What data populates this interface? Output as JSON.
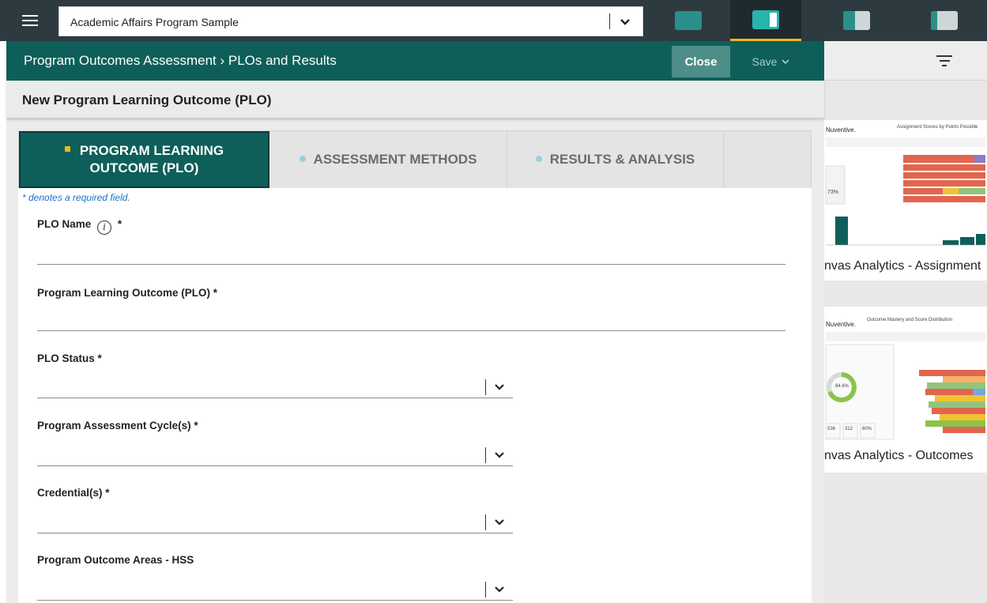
{
  "topbar": {
    "org_select_value": "Academic Affairs Program Sample",
    "layout_buttons": [
      {
        "name": "layout-full"
      },
      {
        "name": "layout-split-right",
        "active": true
      },
      {
        "name": "layout-split-left"
      },
      {
        "name": "layout-split-center"
      }
    ]
  },
  "modal": {
    "breadcrumb": "Program Outcomes Assessment  ›  PLOs and Results",
    "close_label": "Close",
    "save_label": "Save",
    "subtitle": "New Program Learning Outcome (PLO)",
    "tabs": [
      {
        "line1": "PROGRAM LEARNING",
        "line2": "OUTCOME (PLO)",
        "active": true
      },
      {
        "label": "ASSESSMENT METHODS",
        "active": false
      },
      {
        "label": "RESULTS & ANALYSIS",
        "active": false
      }
    ],
    "required_note": "* denotes a required field.",
    "fields": [
      {
        "label": "PLO Name",
        "required_mark": "*",
        "type": "text",
        "value": ""
      },
      {
        "label": "Program Learning Outcome (PLO) *",
        "type": "text",
        "value": ""
      },
      {
        "label": "PLO Status *",
        "type": "select",
        "value": ""
      },
      {
        "label": "Program Assessment Cycle(s) *",
        "type": "select",
        "value": ""
      },
      {
        "label": "Credential(s) *",
        "type": "select",
        "value": ""
      },
      {
        "label": "Program Outcome Areas - HSS",
        "type": "select",
        "value": ""
      }
    ]
  },
  "right_panel": {
    "cards": [
      {
        "caption": "nvas Analytics - Assignment",
        "thumb_brand": "Nuventive.",
        "thumb_title": "Assignment Scores by Points Possible",
        "thumb_stat": "73%"
      },
      {
        "caption": "nvas Analytics - Outcomes",
        "thumb_brand": "Nuventive.",
        "thumb_title": "Outcome Mastery and Score Distribution",
        "thumb_stat": "84.6%",
        "thumb_numbers": [
          "536",
          "312",
          "60%"
        ]
      }
    ]
  },
  "colors": {
    "topbar_bg": "#2d3a40",
    "brand_teal": "#0e5f59",
    "accent_yellow": "#f2b61c",
    "link_blue": "#1f6fc5"
  }
}
